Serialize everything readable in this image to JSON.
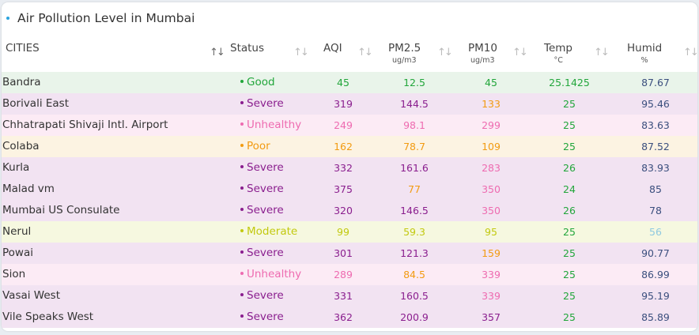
{
  "title": "Air Pollution Level in Mumbai",
  "columns": [
    {
      "key": "cities",
      "label": "CITIES",
      "sub": ""
    },
    {
      "key": "status",
      "label": "Status",
      "sub": ""
    },
    {
      "key": "aqi",
      "label": "AQI",
      "sub": ""
    },
    {
      "key": "pm25",
      "label": "PM2.5",
      "sub": "ug/m3"
    },
    {
      "key": "pm10",
      "label": "PM10",
      "sub": "ug/m3"
    },
    {
      "key": "temp",
      "label": "Temp",
      "sub": "°C"
    },
    {
      "key": "humid",
      "label": "Humid",
      "sub": "%"
    }
  ],
  "sort_icon": "sort-arrows-icon",
  "status_colors": {
    "Good": {
      "text": "#22a63b",
      "row": "#e9f4ea"
    },
    "Severe": {
      "text": "#8a1e8e",
      "row": "#f2e3f2"
    },
    "Unhealthy": {
      "text": "#ee6bb0",
      "row": "#fcebf5"
    },
    "Poor": {
      "text": "#f29b12",
      "row": "#fcf3e2"
    },
    "Moderate": {
      "text": "#c2c90f",
      "row": "#f6f8e0"
    }
  },
  "value_colors": {
    "green": "#22a63b",
    "purple": "#8a1e8e",
    "pink": "#ee6bb0",
    "orange": "#f29b12",
    "yellow": "#c2c90f",
    "navy": "#3b4f7e",
    "lightblue": "#8fc9e0"
  },
  "rows": [
    {
      "city": "Bandra",
      "status": "Good",
      "aqi": "45",
      "aqi_c": "green",
      "pm25": "12.5",
      "pm25_c": "green",
      "pm10": "45",
      "pm10_c": "green",
      "temp": "25.1425",
      "temp_c": "green",
      "humid": "87.67",
      "humid_c": "navy"
    },
    {
      "city": "Borivali East",
      "status": "Severe",
      "aqi": "319",
      "aqi_c": "purple",
      "pm25": "144.5",
      "pm25_c": "purple",
      "pm10": "133",
      "pm10_c": "orange",
      "temp": "25",
      "temp_c": "green",
      "humid": "95.46",
      "humid_c": "navy"
    },
    {
      "city": "Chhatrapati Shivaji Intl. Airport",
      "status": "Unhealthy",
      "aqi": "249",
      "aqi_c": "pink",
      "pm25": "98.1",
      "pm25_c": "pink",
      "pm10": "299",
      "pm10_c": "pink",
      "temp": "25",
      "temp_c": "green",
      "humid": "83.63",
      "humid_c": "navy"
    },
    {
      "city": "Colaba",
      "status": "Poor",
      "aqi": "162",
      "aqi_c": "orange",
      "pm25": "78.7",
      "pm25_c": "orange",
      "pm10": "109",
      "pm10_c": "orange",
      "temp": "25",
      "temp_c": "green",
      "humid": "87.52",
      "humid_c": "navy"
    },
    {
      "city": "Kurla",
      "status": "Severe",
      "aqi": "332",
      "aqi_c": "purple",
      "pm25": "161.6",
      "pm25_c": "purple",
      "pm10": "283",
      "pm10_c": "pink",
      "temp": "26",
      "temp_c": "green",
      "humid": "83.93",
      "humid_c": "navy"
    },
    {
      "city": "Malad vm",
      "status": "Severe",
      "aqi": "375",
      "aqi_c": "purple",
      "pm25": "77",
      "pm25_c": "orange",
      "pm10": "350",
      "pm10_c": "pink",
      "temp": "24",
      "temp_c": "green",
      "humid": "85",
      "humid_c": "navy"
    },
    {
      "city": "Mumbai US Consulate",
      "status": "Severe",
      "aqi": "320",
      "aqi_c": "purple",
      "pm25": "146.5",
      "pm25_c": "purple",
      "pm10": "350",
      "pm10_c": "pink",
      "temp": "26",
      "temp_c": "green",
      "humid": "78",
      "humid_c": "navy"
    },
    {
      "city": "Nerul",
      "status": "Moderate",
      "aqi": "99",
      "aqi_c": "yellow",
      "pm25": "59.3",
      "pm25_c": "yellow",
      "pm10": "95",
      "pm10_c": "yellow",
      "temp": "25",
      "temp_c": "green",
      "humid": "56",
      "humid_c": "lightblue"
    },
    {
      "city": "Powai",
      "status": "Severe",
      "aqi": "301",
      "aqi_c": "purple",
      "pm25": "121.3",
      "pm25_c": "purple",
      "pm10": "159",
      "pm10_c": "orange",
      "temp": "25",
      "temp_c": "green",
      "humid": "90.77",
      "humid_c": "navy"
    },
    {
      "city": "Sion",
      "status": "Unhealthy",
      "aqi": "289",
      "aqi_c": "pink",
      "pm25": "84.5",
      "pm25_c": "orange",
      "pm10": "339",
      "pm10_c": "pink",
      "temp": "25",
      "temp_c": "green",
      "humid": "86.99",
      "humid_c": "navy"
    },
    {
      "city": "Vasai West",
      "status": "Severe",
      "aqi": "331",
      "aqi_c": "purple",
      "pm25": "160.5",
      "pm25_c": "purple",
      "pm10": "339",
      "pm10_c": "pink",
      "temp": "25",
      "temp_c": "green",
      "humid": "95.19",
      "humid_c": "navy"
    },
    {
      "city": "Vile Speaks West",
      "status": "Severe",
      "aqi": "362",
      "aqi_c": "purple",
      "pm25": "200.9",
      "pm25_c": "purple",
      "pm10": "357",
      "pm10_c": "purple",
      "temp": "25",
      "temp_c": "green",
      "humid": "85.89",
      "humid_c": "navy"
    }
  ]
}
